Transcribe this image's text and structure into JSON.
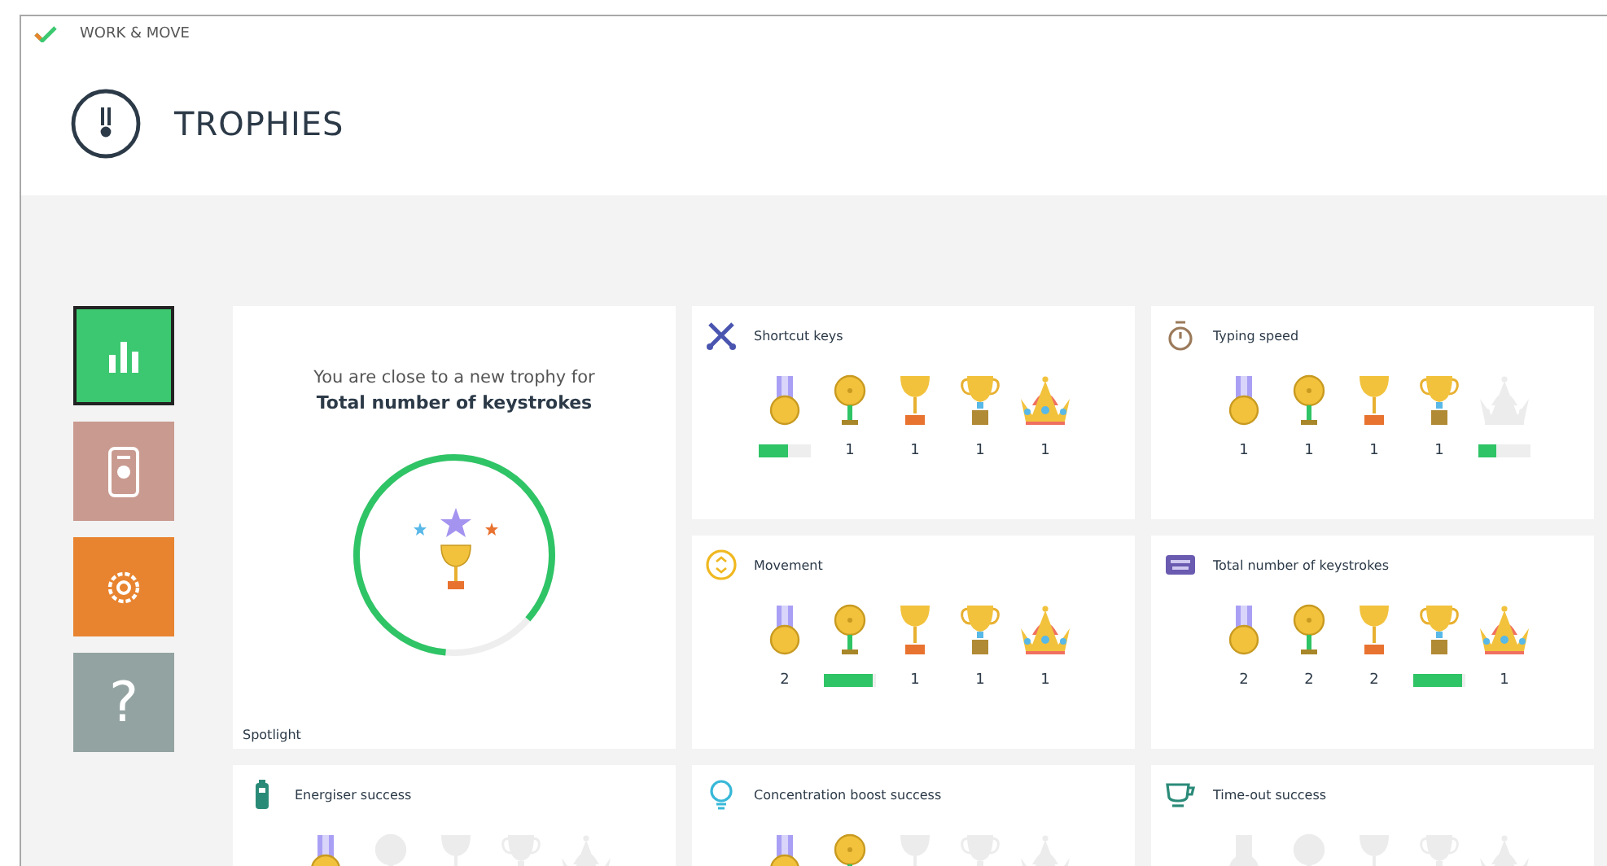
{
  "app": {
    "name": "WORK & MOVE"
  },
  "page": {
    "title": "TROPHIES"
  },
  "sidebar": [
    {
      "kind": "stats",
      "selected": true,
      "color": "#3cc870"
    },
    {
      "kind": "device",
      "selected": false,
      "color": "#c99a90"
    },
    {
      "kind": "settings",
      "selected": false,
      "color": "#e8842f"
    },
    {
      "kind": "help",
      "label": "?",
      "selected": false,
      "color": "#93a3a1"
    }
  ],
  "spotlight": {
    "intro": "You are close to a new trophy for",
    "category": "Total number of keystrokes",
    "level": 0.85,
    "label": "Spotlight"
  },
  "categories": [
    {
      "title": "Shortcut keys",
      "tiers": [
        {
          "kind": "medal",
          "earned": true,
          "level": 0.55
        },
        {
          "kind": "coin",
          "earned": true,
          "count": "1"
        },
        {
          "kind": "cup",
          "earned": true,
          "count": "1"
        },
        {
          "kind": "trophy",
          "earned": true,
          "count": "1"
        },
        {
          "kind": "crown",
          "earned": true,
          "count": "1"
        }
      ]
    },
    {
      "title": "Typing speed",
      "tiers": [
        {
          "kind": "medal",
          "earned": true,
          "count": "1"
        },
        {
          "kind": "coin",
          "earned": true,
          "count": "1"
        },
        {
          "kind": "cup",
          "earned": true,
          "count": "1"
        },
        {
          "kind": "trophy",
          "earned": true,
          "count": "1"
        },
        {
          "kind": "crown",
          "earned": false,
          "level": 0.35
        }
      ]
    },
    {
      "title": "Movement",
      "tiers": [
        {
          "kind": "medal",
          "earned": true,
          "count": "2"
        },
        {
          "kind": "coin",
          "earned": true,
          "level": 0.95
        },
        {
          "kind": "cup",
          "earned": true,
          "count": "1"
        },
        {
          "kind": "trophy",
          "earned": true,
          "count": "1"
        },
        {
          "kind": "crown",
          "earned": true,
          "count": "1"
        }
      ]
    },
    {
      "title": "Total number of keystrokes",
      "tiers": [
        {
          "kind": "medal",
          "earned": true,
          "count": "2"
        },
        {
          "kind": "coin",
          "earned": true,
          "count": "2"
        },
        {
          "kind": "cup",
          "earned": true,
          "count": "2"
        },
        {
          "kind": "trophy",
          "earned": true,
          "level": 0.95
        },
        {
          "kind": "crown",
          "earned": true,
          "count": "1"
        }
      ]
    },
    {
      "title": "Energiser success",
      "tiers": [
        {
          "kind": "medal",
          "earned": true
        },
        {
          "kind": "coin",
          "earned": false
        },
        {
          "kind": "cup",
          "earned": false
        },
        {
          "kind": "trophy",
          "earned": false
        },
        {
          "kind": "crown",
          "earned": false
        }
      ]
    },
    {
      "title": "Concentration boost success",
      "tiers": [
        {
          "kind": "medal",
          "earned": true
        },
        {
          "kind": "coin",
          "earned": true
        },
        {
          "kind": "cup",
          "earned": false
        },
        {
          "kind": "trophy",
          "earned": false
        },
        {
          "kind": "crown",
          "earned": false
        }
      ]
    },
    {
      "title": "Time-out success",
      "tiers": [
        {
          "kind": "medal",
          "earned": false
        },
        {
          "kind": "coin",
          "earned": false
        },
        {
          "kind": "cup",
          "earned": false
        },
        {
          "kind": "trophy",
          "earned": false
        },
        {
          "kind": "crown",
          "earned": false
        }
      ]
    }
  ]
}
